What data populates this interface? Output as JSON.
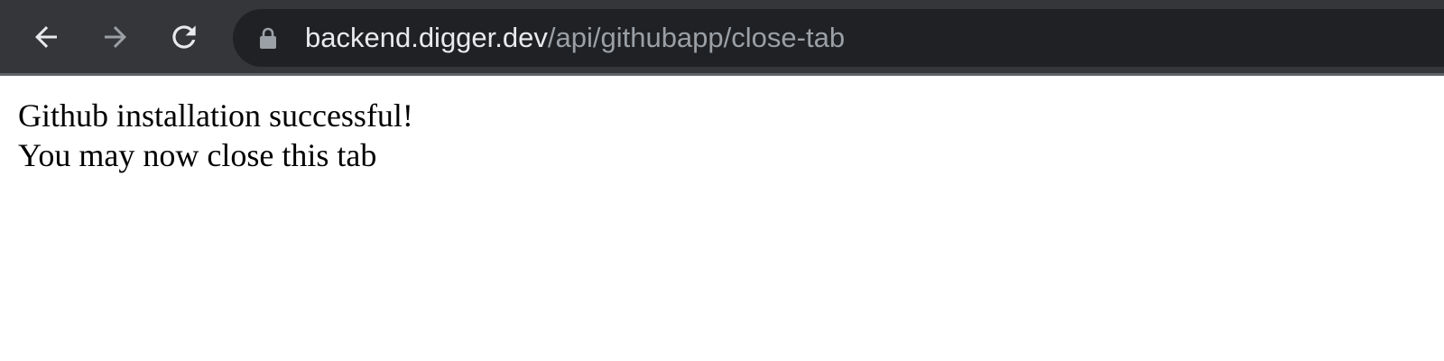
{
  "browser": {
    "back_icon": "arrow-left-icon",
    "forward_icon": "arrow-right-icon",
    "reload_icon": "reload-icon",
    "lock_icon": "lock-icon",
    "url_host": "backend.digger.dev",
    "url_path": "/api/githubapp/close-tab",
    "colors": {
      "toolbar": "#35363a",
      "omnibox": "#202124",
      "icon_active": "#e8eaed",
      "icon_disabled": "#9aa0a6"
    }
  },
  "page": {
    "line1": "Github installation successful!",
    "line2": "You may now close this tab"
  }
}
